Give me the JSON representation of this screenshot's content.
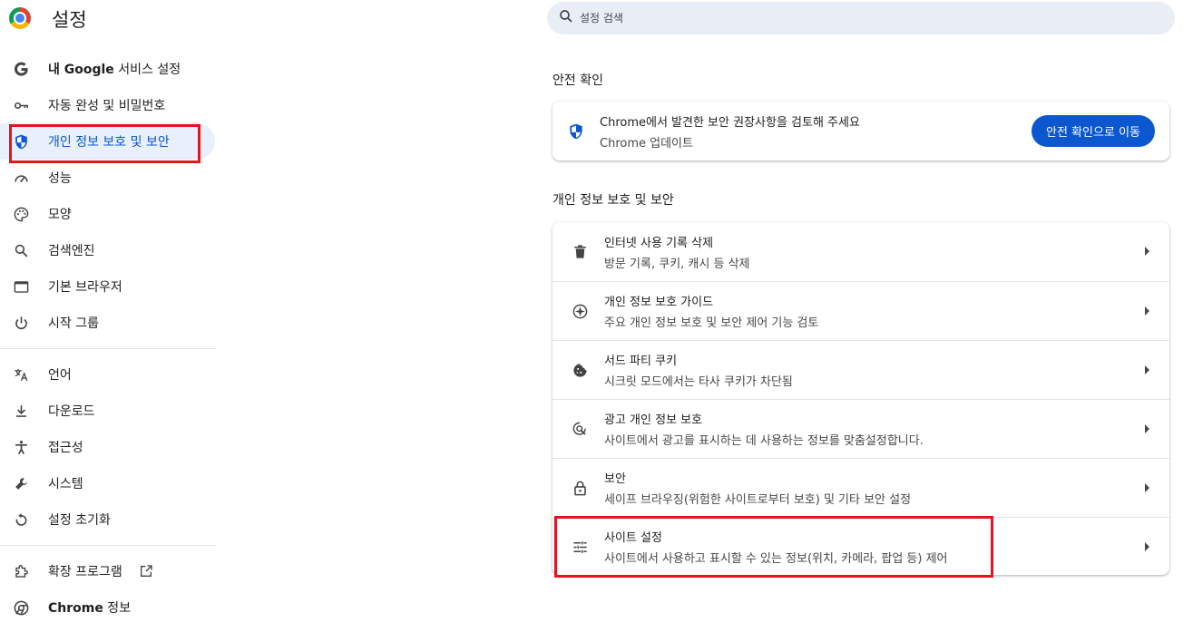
{
  "app": {
    "title": "설정"
  },
  "search": {
    "placeholder": "설정 검색"
  },
  "sidebar": {
    "items": [
      {
        "label_bold": "내 Google",
        "label": " 서비스 설정",
        "icon": "google-icon"
      },
      {
        "label": "자동 완성 및 비밀번호",
        "icon": "key-icon"
      },
      {
        "label": "개인 정보 보호 및 보안",
        "icon": "shield-icon",
        "active": true
      },
      {
        "label": "성능",
        "icon": "speedometer-icon"
      },
      {
        "label": "모양",
        "icon": "palette-icon"
      },
      {
        "label": "검색엔진",
        "icon": "search-icon"
      },
      {
        "label": "기본 브라우저",
        "icon": "browser-window-icon"
      },
      {
        "label": "시작 그룹",
        "icon": "power-icon"
      },
      {
        "label": "언어",
        "icon": "translate-icon"
      },
      {
        "label": "다운로드",
        "icon": "download-icon"
      },
      {
        "label": "접근성",
        "icon": "accessibility-icon"
      },
      {
        "label": "시스템",
        "icon": "wrench-icon"
      },
      {
        "label": "설정 초기화",
        "icon": "reset-icon"
      },
      {
        "label": "확장 프로그램",
        "icon": "puzzle-icon"
      },
      {
        "label_bold": "Chrome",
        "label": " 정보",
        "icon": "chrome-icon"
      }
    ]
  },
  "safety_check": {
    "heading": "안전 확인",
    "title": "Chrome에서 발견한 보안 권장사항을 검토해 주세요",
    "subtitle": "Chrome 업데이트",
    "button": "안전 확인으로 이동"
  },
  "privacy": {
    "heading": "개인 정보 보호 및 보안",
    "rows": [
      {
        "title": "인터넷 사용 기록 삭제",
        "subtitle": "방문 기록, 쿠키, 캐시 등 삭제",
        "icon": "trash-icon"
      },
      {
        "title": "개인 정보 보호 가이드",
        "subtitle": "주요 개인 정보 보호 및 보안 제어 기능 검토",
        "icon": "compass-icon"
      },
      {
        "title": "서드 파티 쿠키",
        "subtitle": "시크릿 모드에서는 타사 쿠키가 차단됨",
        "icon": "cookie-icon"
      },
      {
        "title": "광고 개인 정보 보호",
        "subtitle": "사이트에서 광고를 표시하는 데 사용하는 정보를 맞춤설정합니다.",
        "icon": "ad-privacy-icon"
      },
      {
        "title": "보안",
        "subtitle": "세이프 브라우징(위험한 사이트로부터 보호) 및 기타 보안 설정",
        "icon": "lock-icon"
      },
      {
        "title": "사이트 설정",
        "subtitle": "사이트에서 사용하고 표시할 수 있는 정보(위치, 카메라, 팝업 등) 제어",
        "icon": "sliders-icon"
      }
    ]
  },
  "colors": {
    "accent": "#0b57d0",
    "highlight": "#e3141f",
    "active_bg": "#e8f0fe"
  }
}
